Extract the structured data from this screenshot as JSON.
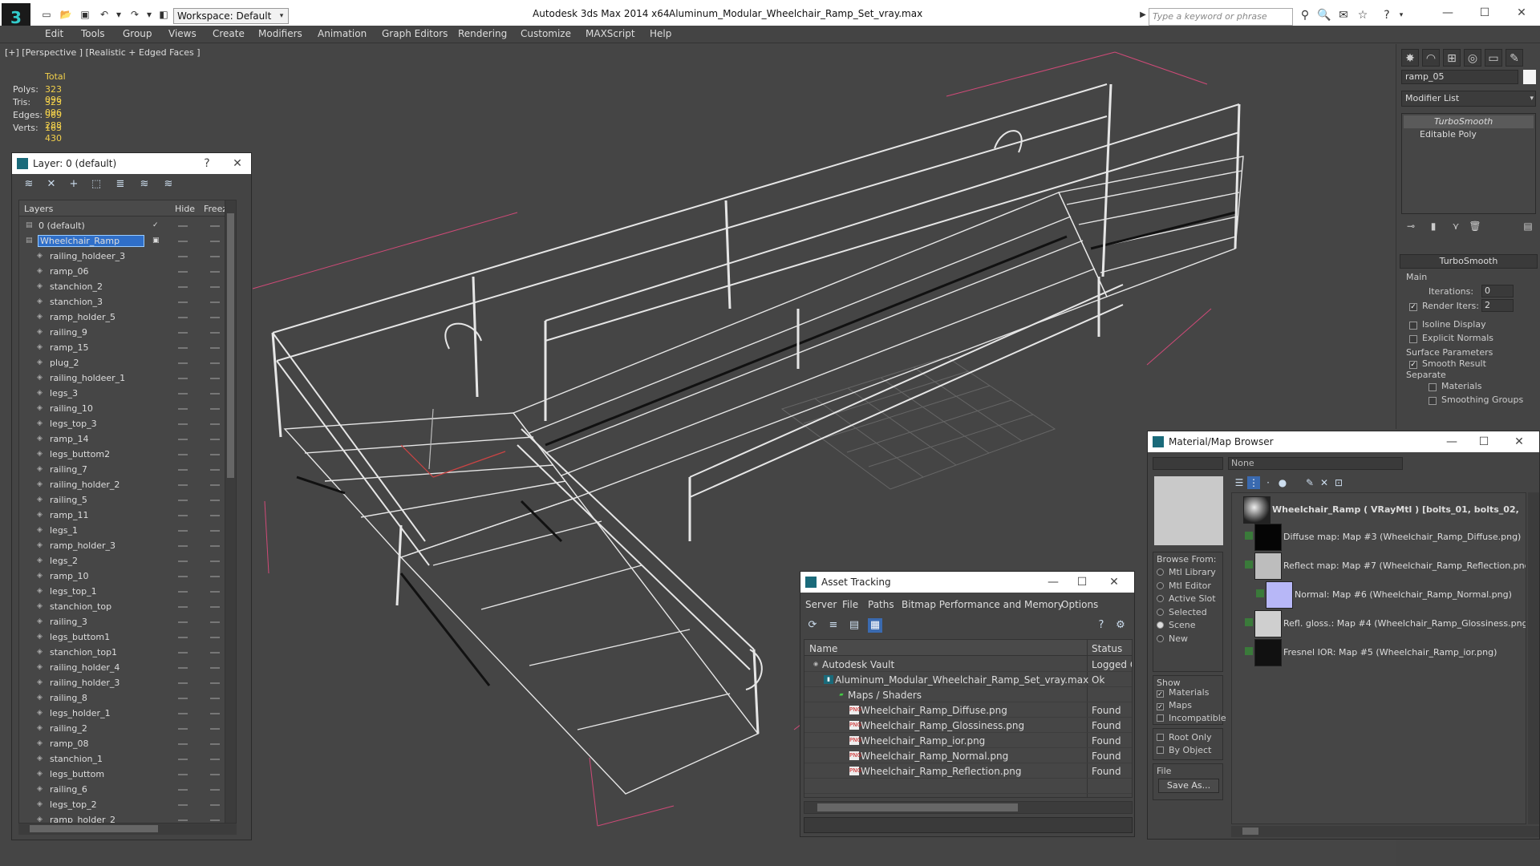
{
  "titlebar": {
    "app_name": "Autodesk 3ds Max  2014 x64",
    "file_name": "Aluminum_Modular_Wheelchair_Ramp_Set_vray.max",
    "workspace": "Workspace: Default",
    "search_placeholder": "Type a keyword or phrase"
  },
  "menu": [
    "Edit",
    "Tools",
    "Group",
    "Views",
    "Create",
    "Modifiers",
    "Animation",
    "Graph Editors",
    "Rendering",
    "Customize",
    "MAXScript",
    "Help"
  ],
  "viewport": {
    "label": "[+] [Perspective ] [Realistic + Edged Faces ]",
    "stats_header": "Total",
    "stats": [
      {
        "label": "Polys:",
        "value": "323 096"
      },
      {
        "label": "Tris:",
        "value": "323 096"
      },
      {
        "label": "Edges:",
        "value": "969 288"
      },
      {
        "label": "Verts:",
        "value": "163 430"
      }
    ]
  },
  "layer_window": {
    "title": "Layer: 0 (default)",
    "col_layers": "Layers",
    "col_hide": "Hide",
    "col_freeze": "Freeze",
    "layers": [
      {
        "name": "0 (default)",
        "level": 0
      },
      {
        "name": "Wheelchair_Ramp",
        "level": 0,
        "selected": true
      },
      {
        "name": "railing_holdeer_3",
        "level": 1
      },
      {
        "name": "ramp_06",
        "level": 1
      },
      {
        "name": "stanchion_2",
        "level": 1
      },
      {
        "name": "stanchion_3",
        "level": 1
      },
      {
        "name": "ramp_holder_5",
        "level": 1
      },
      {
        "name": "railing_9",
        "level": 1
      },
      {
        "name": "ramp_15",
        "level": 1
      },
      {
        "name": "plug_2",
        "level": 1
      },
      {
        "name": "railing_holdeer_1",
        "level": 1
      },
      {
        "name": "legs_3",
        "level": 1
      },
      {
        "name": "railing_10",
        "level": 1
      },
      {
        "name": "legs_top_3",
        "level": 1
      },
      {
        "name": "ramp_14",
        "level": 1
      },
      {
        "name": "legs_buttom2",
        "level": 1
      },
      {
        "name": "railing_7",
        "level": 1
      },
      {
        "name": "railing_holder_2",
        "level": 1
      },
      {
        "name": "railing_5",
        "level": 1
      },
      {
        "name": "ramp_11",
        "level": 1
      },
      {
        "name": "legs_1",
        "level": 1
      },
      {
        "name": "ramp_holder_3",
        "level": 1
      },
      {
        "name": "legs_2",
        "level": 1
      },
      {
        "name": "ramp_10",
        "level": 1
      },
      {
        "name": "legs_top_1",
        "level": 1
      },
      {
        "name": "stanchion_top",
        "level": 1
      },
      {
        "name": "railing_3",
        "level": 1
      },
      {
        "name": "legs_buttom1",
        "level": 1
      },
      {
        "name": "stanchion_top1",
        "level": 1
      },
      {
        "name": "railing_holder_4",
        "level": 1
      },
      {
        "name": "railing_holder_3",
        "level": 1
      },
      {
        "name": "railing_8",
        "level": 1
      },
      {
        "name": "legs_holder_1",
        "level": 1
      },
      {
        "name": "railing_2",
        "level": 1
      },
      {
        "name": "ramp_08",
        "level": 1
      },
      {
        "name": "stanchion_1",
        "level": 1
      },
      {
        "name": "legs_buttom",
        "level": 1
      },
      {
        "name": "railing_6",
        "level": 1
      },
      {
        "name": "legs_top_2",
        "level": 1
      },
      {
        "name": "ramp_holder_2",
        "level": 1
      }
    ]
  },
  "command_panel": {
    "object_name": "ramp_05",
    "modifier_list": "Modifier List",
    "stack": [
      "TurboSmooth",
      "Editable Poly"
    ],
    "rollout_title": "TurboSmooth",
    "main_label": "Main",
    "iterations_label": "Iterations:",
    "iterations_value": "0",
    "render_iters_label": "Render Iters:",
    "render_iters_value": "2",
    "isoline_label": "Isoline Display",
    "explicit_normals_label": "Explicit Normals",
    "surface_params_label": "Surface Parameters",
    "smooth_result_label": "Smooth Result",
    "separate_label": "Separate",
    "materials_label": "Materials",
    "smoothing_groups_label": "Smoothing Groups"
  },
  "asset_tracking": {
    "title": "Asset Tracking",
    "menu": [
      "Server",
      "File",
      "Paths",
      "Bitmap Performance and Memory",
      "Options"
    ],
    "col_name": "Name",
    "col_status": "Status",
    "rows": [
      {
        "name": "Autodesk Vault",
        "status": "Logged O",
        "indent": 0,
        "icon": "vault"
      },
      {
        "name": "Aluminum_Modular_Wheelchair_Ramp_Set_vray.max",
        "status": "Ok",
        "indent": 1,
        "icon": "max"
      },
      {
        "name": "Maps / Shaders",
        "status": "",
        "indent": 2,
        "icon": "maps"
      },
      {
        "name": "Wheelchair_Ramp_Diffuse.png",
        "status": "Found",
        "indent": 3,
        "icon": "png"
      },
      {
        "name": "Wheelchair_Ramp_Glossiness.png",
        "status": "Found",
        "indent": 3,
        "icon": "png"
      },
      {
        "name": "Wheelchair_Ramp_ior.png",
        "status": "Found",
        "indent": 3,
        "icon": "png"
      },
      {
        "name": "Wheelchair_Ramp_Normal.png",
        "status": "Found",
        "indent": 3,
        "icon": "png"
      },
      {
        "name": "Wheelchair_Ramp_Reflection.png",
        "status": "Found",
        "indent": 3,
        "icon": "png"
      }
    ]
  },
  "material_browser": {
    "title": "Material/Map Browser",
    "search_value": "None",
    "browse_from_label": "Browse From:",
    "browse_from": [
      {
        "label": "Mtl Library",
        "selected": false
      },
      {
        "label": "Mtl Editor",
        "selected": false
      },
      {
        "label": "Active Slot",
        "selected": false
      },
      {
        "label": "Selected",
        "selected": false
      },
      {
        "label": "Scene",
        "selected": true
      },
      {
        "label": "New",
        "selected": false
      }
    ],
    "show_label": "Show",
    "show": [
      {
        "label": "Materials",
        "checked": true
      },
      {
        "label": "Maps",
        "checked": true
      },
      {
        "label": "Incompatible",
        "checked": false
      }
    ],
    "filters": [
      {
        "label": "Root Only",
        "checked": false
      },
      {
        "label": "By Object",
        "checked": false
      }
    ],
    "file_label": "File",
    "save_as_label": "Save As...",
    "tree": [
      {
        "label": "Wheelchair_Ramp  ( VRayMtl )  [bolts_01, bolts_02,",
        "level": 0,
        "thumb": "sphere",
        "bold": true
      },
      {
        "label": "Diffuse map: Map #3 (Wheelchair_Ramp_Diffuse.png)",
        "level": 1,
        "thumb": "black"
      },
      {
        "label": "Reflect map: Map #7 (Wheelchair_Ramp_Reflection.png)",
        "level": 1,
        "thumb": "grey"
      },
      {
        "label": "Normal: Map #6 (Wheelchair_Ramp_Normal.png)",
        "level": 2,
        "thumb": "blue"
      },
      {
        "label": "Refl. gloss.: Map #4 (Wheelchair_Ramp_Glossiness.png)",
        "level": 1,
        "thumb": "lightgrey"
      },
      {
        "label": "Fresnel IOR: Map #5 (Wheelchair_Ramp_ior.png)",
        "level": 1,
        "thumb": "dark"
      }
    ]
  },
  "colors": {
    "stats_yellow": "#f2d04b",
    "selection_blue": "#2f6fc9",
    "wireframe": "#e6e6e6",
    "bbox_pink": "#d04a78",
    "grid": "#666666"
  }
}
